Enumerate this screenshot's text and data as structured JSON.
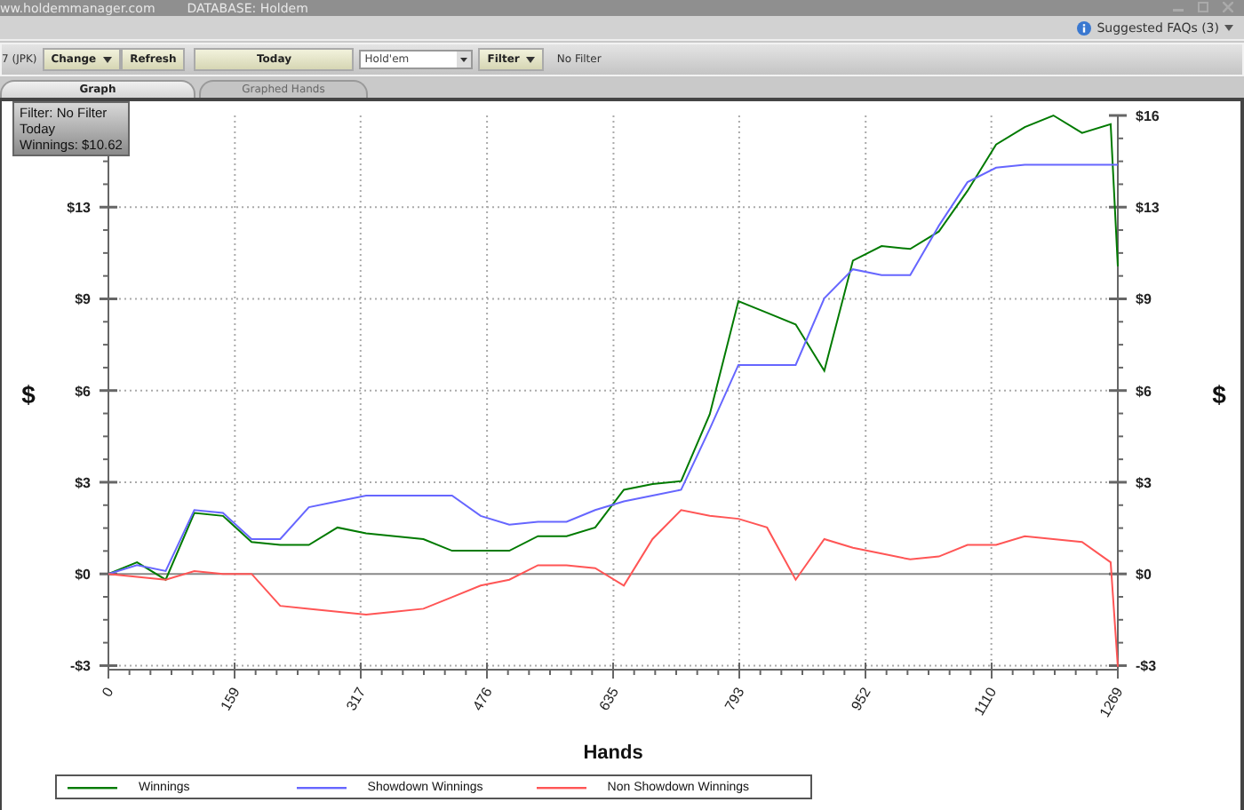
{
  "title_bar": {
    "site": "ww.holdemmanager.com",
    "database": "DATABASE: Holdem"
  },
  "help_bar": {
    "faq": "Suggested FAQs (3)"
  },
  "toolbar": {
    "player": "7 (JPK)",
    "change": "Change",
    "refresh": "Refresh",
    "today": "Today",
    "game": "Hold'em",
    "filter": "Filter",
    "filter_status": "No Filter"
  },
  "tabs": [
    {
      "label": "Graph",
      "selected": true
    },
    {
      "label": "Graphed Hands",
      "selected": false
    }
  ],
  "info_box": [
    "Filter: No Filter",
    "Today",
    "Winnings: $10.62"
  ],
  "chart_data": {
    "type": "line",
    "xlabel": "Hands",
    "ylabel": "$",
    "x": [
      0,
      36,
      72,
      108,
      144,
      180,
      216,
      252,
      288,
      324,
      360,
      396,
      432,
      468,
      504,
      540,
      576,
      612,
      648,
      684,
      720,
      756,
      792,
      828,
      864,
      900,
      936,
      972,
      1008,
      1044,
      1080,
      1116,
      1152,
      1188,
      1224,
      1260,
      1269
    ],
    "series": [
      {
        "name": "Winnings",
        "color": "#007a00",
        "values": [
          0,
          0.4,
          -0.2,
          2.1,
          2.0,
          1.1,
          1.0,
          1.0,
          1.6,
          1.4,
          1.3,
          1.2,
          0.8,
          0.8,
          0.8,
          1.3,
          1.3,
          1.6,
          2.9,
          3.1,
          3.2,
          5.5,
          9.4,
          9.0,
          8.6,
          7.0,
          10.8,
          11.3,
          11.2,
          11.8,
          13.2,
          14.8,
          15.4,
          15.8,
          15.2,
          15.5,
          10.6
        ]
      },
      {
        "name": "Showdown Winnings",
        "color": "#6666ff",
        "values": [
          0,
          0.3,
          0.1,
          2.2,
          2.1,
          1.2,
          1.2,
          2.3,
          2.5,
          2.7,
          2.7,
          2.7,
          2.7,
          2.0,
          1.7,
          1.8,
          1.8,
          2.2,
          2.5,
          2.7,
          2.9,
          5.0,
          7.2,
          7.2,
          7.2,
          9.5,
          10.5,
          10.3,
          10.3,
          12.0,
          13.5,
          14.0,
          14.1,
          14.1,
          14.1,
          14.1,
          14.1
        ]
      },
      {
        "name": "Non Showdown Winnings",
        "color": "#ff5555",
        "values": [
          0,
          -0.1,
          -0.2,
          0.1,
          0,
          0,
          -1.1,
          -1.2,
          -1.3,
          -1.4,
          -1.3,
          -1.2,
          -0.8,
          -0.4,
          -0.2,
          0.3,
          0.3,
          0.2,
          -0.4,
          1.2,
          2.2,
          2.0,
          1.9,
          1.6,
          -0.2,
          1.2,
          0.9,
          0.7,
          0.5,
          0.6,
          1.0,
          1.0,
          1.3,
          1.2,
          1.1,
          0.4,
          -3.2
        ]
      }
    ],
    "xlim": [
      0,
      1269
    ],
    "ylim": [
      -3.3,
      15.8
    ],
    "grid": true,
    "xticks": [
      0,
      159,
      317,
      476,
      635,
      793,
      952,
      1110,
      1269
    ],
    "yticks": [
      {
        "value": -3.16,
        "label": "-$3"
      },
      {
        "value": 0,
        "label": "$0"
      },
      {
        "value": 3.16,
        "label": "$3"
      },
      {
        "value": 6.32,
        "label": "$6"
      },
      {
        "value": 9.48,
        "label": "$9"
      },
      {
        "value": 12.64,
        "label": "$13"
      },
      {
        "value": 15.8,
        "label": "$16"
      }
    ]
  }
}
